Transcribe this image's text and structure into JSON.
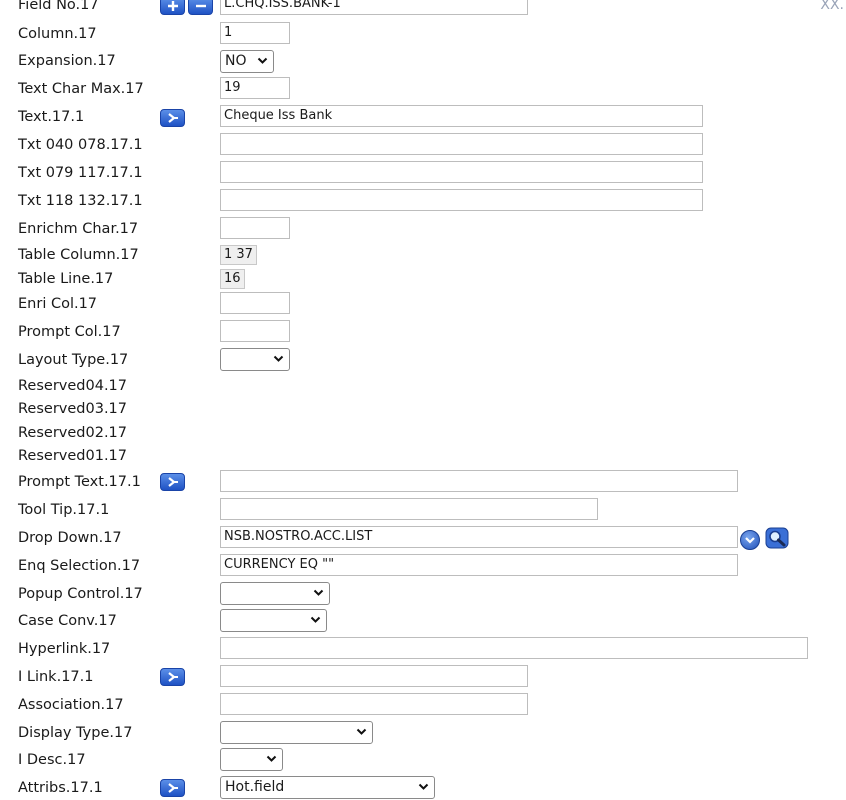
{
  "corner_text": "XX.",
  "rows": {
    "field_no": {
      "label": "Field No.17",
      "value": "L.CHQ.ISS.BANK-1"
    },
    "column": {
      "label": "Column.17",
      "value": "1"
    },
    "expansion": {
      "label": "Expansion.17",
      "value": "NO"
    },
    "text_char_max": {
      "label": "Text Char Max.17",
      "value": "19"
    },
    "text": {
      "label": "Text.17.1",
      "value": "Cheque Iss Bank"
    },
    "txt_040": {
      "label": "Txt 040 078.17.1",
      "value": ""
    },
    "txt_079": {
      "label": "Txt 079 117.17.1",
      "value": ""
    },
    "txt_118": {
      "label": "Txt 118 132.17.1",
      "value": ""
    },
    "enrichm_char": {
      "label": "Enrichm Char.17",
      "value": ""
    },
    "table_column": {
      "label": "Table Column.17",
      "value": "1 37"
    },
    "table_line": {
      "label": "Table Line.17",
      "value": "16"
    },
    "enri_col": {
      "label": "Enri Col.17",
      "value": ""
    },
    "prompt_col": {
      "label": "Prompt Col.17",
      "value": ""
    },
    "layout_type": {
      "label": "Layout Type.17",
      "value": ""
    },
    "reserved04": {
      "label": "Reserved04.17"
    },
    "reserved03": {
      "label": "Reserved03.17"
    },
    "reserved02": {
      "label": "Reserved02.17"
    },
    "reserved01": {
      "label": "Reserved01.17"
    },
    "prompt_text": {
      "label": "Prompt Text.17.1",
      "value": ""
    },
    "tool_tip": {
      "label": "Tool Tip.17.1",
      "value": ""
    },
    "drop_down": {
      "label": "Drop Down.17",
      "value": "NSB.NOSTRO.ACC.LIST"
    },
    "enq_selection": {
      "label": "Enq Selection.17",
      "value": "CURRENCY EQ \"\""
    },
    "popup_control": {
      "label": "Popup Control.17",
      "value": ""
    },
    "case_conv": {
      "label": "Case Conv.17",
      "value": ""
    },
    "hyperlink": {
      "label": "Hyperlink.17",
      "value": ""
    },
    "i_link": {
      "label": "I Link.17.1",
      "value": ""
    },
    "association": {
      "label": "Association.17",
      "value": ""
    },
    "display_type": {
      "label": "Display Type.17",
      "value": ""
    },
    "i_desc": {
      "label": "I Desc.17",
      "value": ""
    },
    "attribs": {
      "label": "Attribs.17.1",
      "value": "Hot.field"
    }
  },
  "icons": {
    "expand": "expand-arrow-icon",
    "add": "plus-icon",
    "remove": "minus-icon",
    "dropdown": "chevron-down-circle-icon",
    "lookup": "magnifier-icon"
  },
  "colors": {
    "accent": "#1f52c4",
    "border": "#bdbdbd"
  }
}
